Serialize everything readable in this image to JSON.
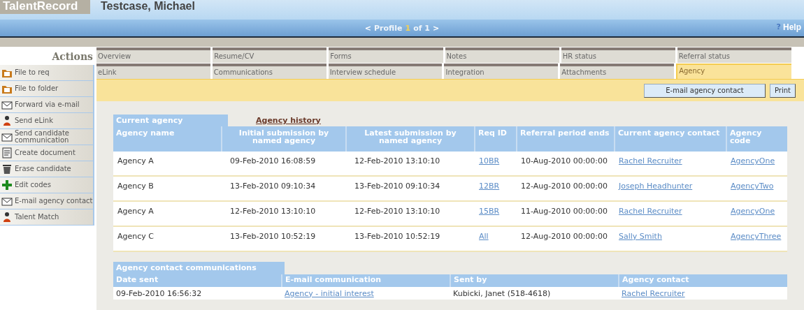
{
  "app": {
    "logo": "TalentRecord",
    "candidate": "Testcase, Michael"
  },
  "pager": {
    "prev": "<",
    "label": "Profile",
    "current": "1",
    "total": "of 1",
    "next": ">"
  },
  "help": {
    "icon": "?",
    "label": "Help"
  },
  "sidebar": {
    "title": "Actions",
    "items": [
      {
        "label": "File to req",
        "kind": "folder"
      },
      {
        "label": "File to folder",
        "kind": "folder"
      },
      {
        "label": "Forward via e-mail",
        "kind": "envelope"
      },
      {
        "label": "Send eLink",
        "kind": "person"
      },
      {
        "label": "Send candidate communication",
        "kind": "envelope"
      },
      {
        "label": "Create document",
        "kind": "document"
      },
      {
        "label": "Erase candidate",
        "kind": "trash"
      },
      {
        "label": "Edit codes",
        "kind": "plus"
      },
      {
        "label": "E-mail agency contact",
        "kind": "envelope"
      },
      {
        "label": "Talent Match",
        "kind": "person"
      }
    ]
  },
  "tabs": [
    [
      {
        "label": "Overview",
        "selected": false
      },
      {
        "label": "Resume/CV",
        "selected": false
      },
      {
        "label": "Forms",
        "selected": false
      },
      {
        "label": "Notes",
        "selected": false
      },
      {
        "label": "HR status",
        "selected": false
      },
      {
        "label": "Referral status",
        "selected": false
      }
    ],
    [
      {
        "label": "eLink",
        "selected": false
      },
      {
        "label": "Communications",
        "selected": false
      },
      {
        "label": "Interview schedule",
        "selected": false
      },
      {
        "label": "Integration",
        "selected": false
      },
      {
        "label": "Attachments",
        "selected": false
      },
      {
        "label": "Agency",
        "selected": true
      }
    ]
  ],
  "toolbar": {
    "buttons": [
      "E-mail agency contact",
      "Print"
    ]
  },
  "subtabs": [
    {
      "label": "Current agency",
      "selected": true
    },
    {
      "label": "Agency history",
      "selected": false
    }
  ],
  "agency_table": {
    "columns": [
      "Agency name",
      "Initial submission by named agency",
      "Latest submission by named agency",
      "Req ID",
      "Referral period ends",
      "Current agency contact",
      "Agency code"
    ],
    "rows": [
      [
        "Agency A",
        "09-Feb-2010 16:08:59",
        "12-Feb-2010 13:10:10",
        "10BR",
        "10-Aug-2010 00:00:00",
        "Rachel Recruiter",
        "AgencyOne"
      ],
      [
        "Agency B",
        "13-Feb-2010 09:10:34",
        "13-Feb-2010 09:10:34",
        "12BR",
        "12-Aug-2010 00:00:00",
        "Joseph Headhunter",
        "AgencyTwo"
      ],
      [
        "Agency A",
        "12-Feb-2010 13:10:10",
        "12-Feb-2010 13:10:10",
        "15BR",
        "11-Aug-2010 00:00:00",
        "Rachel Recruiter",
        "AgencyOne"
      ],
      [
        "Agency C",
        "13-Feb-2010 10:52:19",
        "13-Feb-2010 10:52:19",
        "All",
        "12-Aug-2010 00:00:00",
        "Sally Smith",
        "AgencyThree"
      ]
    ]
  },
  "communications": {
    "title": "Agency contact communications",
    "columns": [
      "Date sent",
      "E-mail communication",
      "Sent by",
      "Agency contact"
    ],
    "rows": [
      [
        "09-Feb-2010 16:56:32",
        "Agency - initial interest",
        "Kubicki, Janet (518-4618)",
        "Rachel Recruiter"
      ]
    ]
  }
}
